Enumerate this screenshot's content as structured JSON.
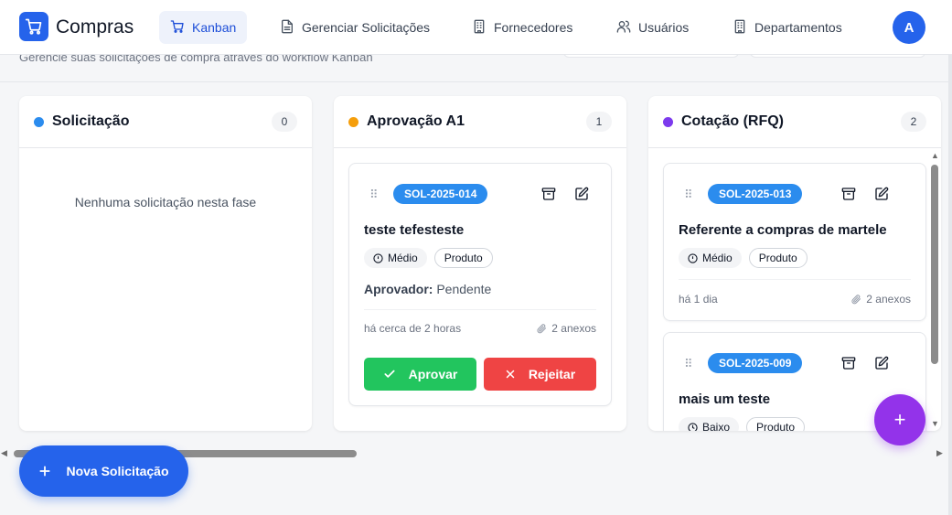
{
  "app": {
    "name": "Compras",
    "avatar_initial": "A"
  },
  "nav": [
    {
      "label": "Kanban",
      "icon": "cart-icon",
      "active": true
    },
    {
      "label": "Gerenciar Solicitações",
      "icon": "document-icon"
    },
    {
      "label": "Fornecedores",
      "icon": "building-icon"
    },
    {
      "label": "Usuários",
      "icon": "users-icon"
    },
    {
      "label": "Departamentos",
      "icon": "building-icon"
    }
  ],
  "page": {
    "subtitle": "Gerencie suas solicitações de compra através do workflow Kanban"
  },
  "columns": [
    {
      "title": "Solicitação",
      "count": "0",
      "color": "#2b8cee",
      "empty_text": "Nenhuma solicitação nesta fase"
    },
    {
      "title": "Aprovação A1",
      "count": "1",
      "color": "#f59e0b",
      "cards": [
        {
          "code": "SOL-2025-014",
          "title": "teste tefesteste",
          "urgency": "Médio",
          "category": "Produto",
          "approver_label": "Aprovador:",
          "approver_value": "Pendente",
          "time": "há cerca de 2 horas",
          "attachments": "2 anexos",
          "approve_label": "Aprovar",
          "reject_label": "Rejeitar"
        }
      ]
    },
    {
      "title": "Cotação (RFQ)",
      "count": "2",
      "color": "#7c3aed",
      "cards": [
        {
          "code": "SOL-2025-013",
          "title": "Referente a compras de martele",
          "urgency": "Médio",
          "category": "Produto",
          "time": "há 1 dia",
          "attachments": "2 anexos"
        },
        {
          "code": "SOL-2025-009",
          "title": "mais um teste",
          "urgency": "Baixo",
          "category": "Produto"
        }
      ]
    }
  ],
  "actions": {
    "new_request": "Nova Solicitação",
    "fab_plus": "+"
  },
  "colors": {
    "primary": "#2563eb",
    "approve": "#22c55e",
    "reject": "#ef4444",
    "fab": "#9333ea",
    "badge": "#2b8cee"
  }
}
